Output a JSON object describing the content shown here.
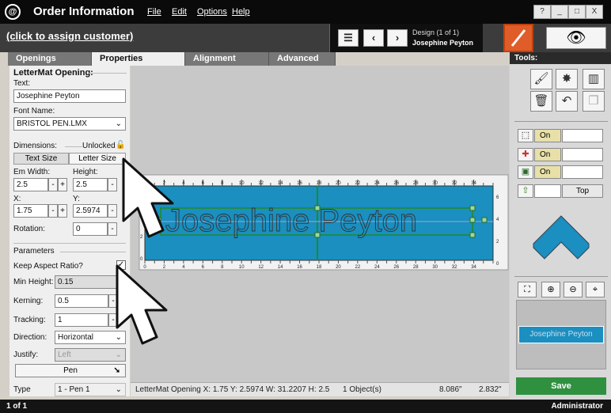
{
  "app": {
    "logo": "@",
    "title": "Order Information"
  },
  "menu": [
    "File",
    "Edit",
    "Options",
    "Help"
  ],
  "window_controls": {
    "help": "?",
    "minimize": "_",
    "maximize": "□",
    "close": "X"
  },
  "customer": {
    "link_label": "(click to assign customer)"
  },
  "design_nav": {
    "menu_glyph": "☰",
    "prev_glyph": "‹",
    "next_glyph": "›",
    "design_label": "Design  (1 of 1)",
    "design_name": "Josephine Peyton"
  },
  "tabs": [
    "Openings",
    "Properties",
    "Alignment",
    "Advanced"
  ],
  "properties": {
    "section_title": "LetterMat Opening:",
    "text_label": "Text:",
    "text_value": "Josephine Peyton",
    "font_label": "Font Name:",
    "font_value": "BRISTOL PEN.LMX",
    "dimensions_label": "Dimensions:",
    "lock_state": "Unlocked",
    "text_size_btn": "Text Size",
    "letter_size_btn": "Letter Size",
    "em_width_label": "Em Width:",
    "em_width_value": "2.5",
    "height_label": "Height:",
    "height_value": "2.5",
    "x_label": "X:",
    "x_value": "1.75",
    "y_label": "Y:",
    "y_value": "2.5974",
    "rotation_label": "Rotation:",
    "rotation_value": "0",
    "minus": "-",
    "plus": "+",
    "parameters_label": "Parameters",
    "keep_aspect_label": "Keep Aspect Ratio?",
    "keep_aspect_checked": true,
    "min_height_label": "Min Height:",
    "min_height_value": "0.15",
    "kerning_label": "Kerning:",
    "kerning_value": "0.5",
    "tracking_label": "Tracking:",
    "tracking_value": "1",
    "direction_label": "Direction:",
    "direction_value": "Horizontal",
    "justify_label": "Justify:",
    "justify_value": "Left",
    "pen_btn": "Pen",
    "type_label": "Type",
    "type_value": "1 - Pen 1"
  },
  "canvas": {
    "mat_color": "#1a8fc0",
    "text": "Josephine Peyton",
    "top_ruler": [
      "2",
      "4",
      "6",
      "8",
      "10",
      "12",
      "14",
      "16",
      "18",
      "20",
      "22",
      "24",
      "26",
      "28",
      "30",
      "32",
      "34"
    ],
    "bottom_ruler": [
      "0",
      "2",
      "4",
      "6",
      "8",
      "10",
      "12",
      "14",
      "16",
      "18",
      "20",
      "22",
      "24",
      "26",
      "28",
      "30",
      "32",
      "34"
    ],
    "side_ruler": [
      "6",
      "4",
      "2",
      "0"
    ],
    "left_ruler": [
      "2",
      "0"
    ]
  },
  "status": {
    "text": "LetterMat Opening  X: 1.75  Y: 2.5974  W: 31.2207  H: 2.5",
    "objects": "1 Object(s)",
    "x_readout": "8.086\"",
    "y_readout": "2.832\""
  },
  "tools": {
    "header": "Tools:",
    "toggles": [
      {
        "icon": "frame-icon",
        "label": "On"
      },
      {
        "icon": "crosshair-icon",
        "label": "On"
      },
      {
        "icon": "grid-icon",
        "label": "On"
      }
    ],
    "top_label": "Top",
    "save_label": "Save",
    "preview_text": "Josephine Peyton"
  },
  "footer": {
    "left": "1 of 1",
    "right": "Administrator"
  }
}
